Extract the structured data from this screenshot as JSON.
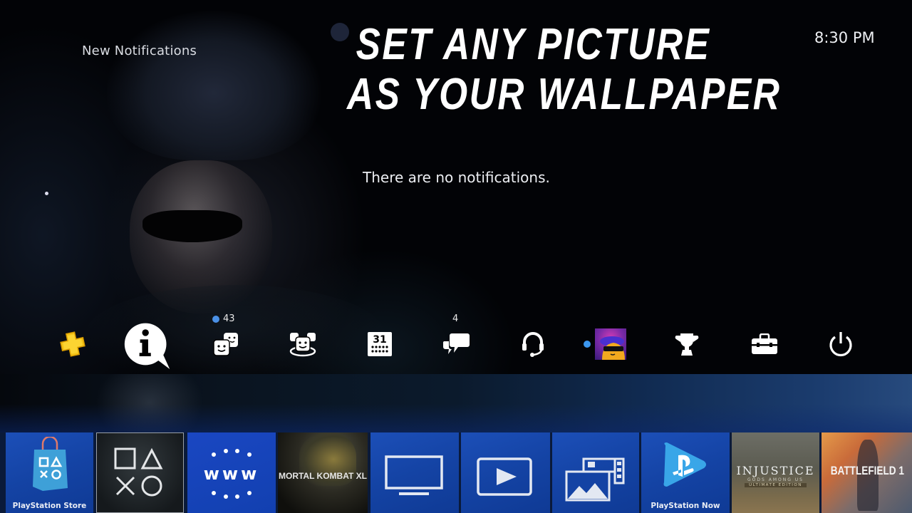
{
  "screen": {
    "section_title": "New Notifications",
    "clock": "8:30 PM",
    "empty_message": "There are no notifications."
  },
  "promo_overlay": {
    "line1": "Set any picture",
    "line2": "as your wallpaper"
  },
  "function_bar": {
    "items": [
      {
        "id": "ps-plus",
        "icon": "ps-plus-icon",
        "color": "#f5c518"
      },
      {
        "id": "notifications",
        "icon": "info-bubble-icon",
        "selected": true
      },
      {
        "id": "friends",
        "icon": "friends-icon",
        "badge": "43",
        "badge_dot": true
      },
      {
        "id": "party",
        "icon": "party-icon"
      },
      {
        "id": "events",
        "icon": "calendar-icon",
        "calendar_day": "31"
      },
      {
        "id": "messages",
        "icon": "messages-icon",
        "badge": "4"
      },
      {
        "id": "party-chat",
        "icon": "headset-icon"
      },
      {
        "id": "profile",
        "icon": "avatar",
        "online": true
      },
      {
        "id": "trophies",
        "icon": "trophy-icon"
      },
      {
        "id": "settings",
        "icon": "toolbox-icon"
      },
      {
        "id": "power",
        "icon": "power-icon"
      }
    ]
  },
  "tiles": [
    {
      "id": "store",
      "label": "PlayStation Store",
      "icon": "store-bag-icon"
    },
    {
      "id": "library",
      "label": "",
      "icon": "ps-shapes-icon"
    },
    {
      "id": "browser",
      "label": "",
      "icon": "www-icon",
      "icon_text": "www"
    },
    {
      "id": "mortal-kombat",
      "title": "MORTAL KOMBAT XL"
    },
    {
      "id": "tv-video",
      "label": "",
      "icon": "tv-icon"
    },
    {
      "id": "video-player",
      "label": "",
      "icon": "play-icon"
    },
    {
      "id": "capture-gallery",
      "label": "",
      "icon": "gallery-icon"
    },
    {
      "id": "ps-now",
      "label": "PlayStation Now",
      "icon": "ps-now-icon"
    },
    {
      "id": "injustice",
      "title": "INJUSTICE",
      "subtitle": "GODS AMONG US",
      "edition": "ULTIMATE EDITION"
    },
    {
      "id": "battlefield",
      "title": "BATTLEFIELD 1"
    }
  ],
  "colors": {
    "badge_dot": "#4a90e6",
    "tile_blue": "#1443a4",
    "ps_plus_gold": "#f5c518"
  }
}
